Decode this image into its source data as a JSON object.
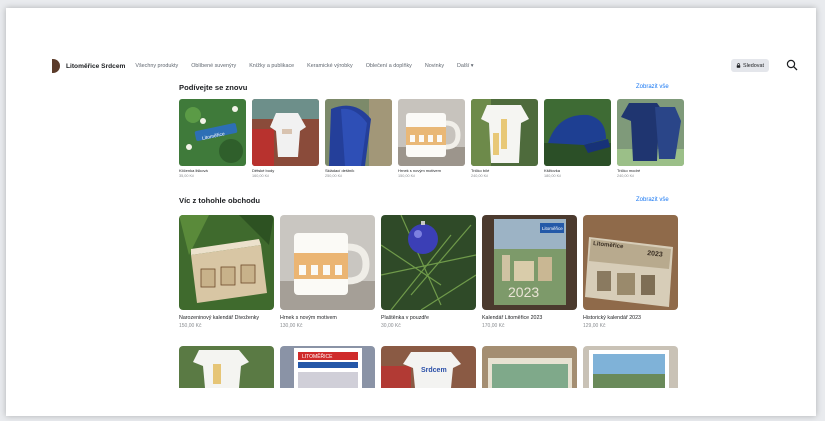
{
  "brand": {
    "name": "Litoměřice Srdcem"
  },
  "nav": {
    "items": [
      "Všechny produkty",
      "Oblíbené suvenýry",
      "Knížky a publikace",
      "Keramické výrobky",
      "Oblečení a doplňky",
      "Novinky"
    ],
    "more_label": "Další ▾"
  },
  "actions": {
    "follow_label": "Sledovat",
    "follow_icon": "lock-icon",
    "search_icon": "search-icon"
  },
  "section1": {
    "title": "Podívejte se znovu",
    "see_all": "Zobrazit vše",
    "items": [
      {
        "name": "Klíčenka lišková",
        "price": "35,00 Kč"
      },
      {
        "name": "Dětské body",
        "price": "160,00 Kč"
      },
      {
        "name": "Skládací deštník",
        "price": "250,00 Kč"
      },
      {
        "name": "Hrnek s novým motivem",
        "price": "150,00 Kč"
      },
      {
        "name": "Tričko bílé",
        "price": "240,00 Kč"
      },
      {
        "name": "Kšiltovka",
        "price": "180,00 Kč"
      },
      {
        "name": "Tričko modré",
        "price": "240,00 Kč"
      }
    ]
  },
  "section2": {
    "title": "Víc z tohohle obchodu",
    "see_all": "Zobrazit vše",
    "items": [
      {
        "name": "Narozeninový kalendář Divoženky",
        "price": "150,00 Kč"
      },
      {
        "name": "Hrnek s novým motivem",
        "price": "130,00 Kč"
      },
      {
        "name": "Plaštěnka v pouzdře",
        "price": "30,00 Kč"
      },
      {
        "name": "Kalendář Litoměřice 2023",
        "price": "170,00 Kč"
      },
      {
        "name": "Historický kalendář 2023",
        "price": "129,00 Kč"
      }
    ]
  },
  "thumb_text": {
    "keychain": "Litoměřice",
    "calendar_brand": "Litoměřice",
    "calendar_year": "2023",
    "hist_title": "Litoměřice",
    "hist_year": "2023",
    "row3_banner1": "LITOMĚŘICE",
    "row3_banner2": "Srdcem"
  },
  "colors": {
    "accent": "#1877f2",
    "muted": "#8a8d91",
    "background": "#e9ebee"
  }
}
